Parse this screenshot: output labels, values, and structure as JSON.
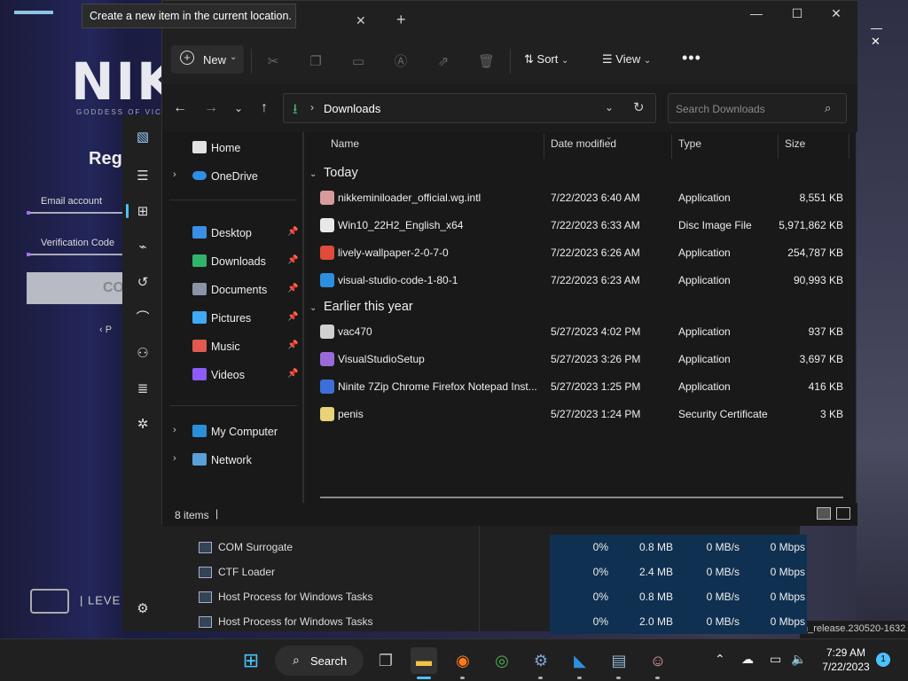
{
  "launcher": {
    "logo": "NIKK",
    "tagline": "GODDESS OF VIC",
    "register_heading": "Regis",
    "email_label": "Email account",
    "verification_label": "Verification Code",
    "button_text": "CO",
    "back_text": "P",
    "studio_text": "LEVE",
    "build_text": "n_release.230520-1632",
    "top_icons": "— ✕"
  },
  "taskmgr": {
    "rows": [
      {
        "name": "COM Surrogate",
        "cpu": "0%",
        "mem": "0.8 MB",
        "disk": "0 MB/s",
        "net": "0 Mbps"
      },
      {
        "name": "CTF Loader",
        "cpu": "0%",
        "mem": "2.4 MB",
        "disk": "0 MB/s",
        "net": "0 Mbps"
      },
      {
        "name": "Host Process for Windows Tasks",
        "cpu": "0%",
        "mem": "0.8 MB",
        "disk": "0 MB/s",
        "net": "0 Mbps"
      },
      {
        "name": "Host Process for Windows Tasks",
        "cpu": "0%",
        "mem": "2.0 MB",
        "disk": "0 MB/s",
        "net": "0 Mbps"
      }
    ]
  },
  "tooltip": {
    "text": "Create a new item in the current location."
  },
  "window": {
    "minimize": "—",
    "maximize": "☐",
    "close": "✕",
    "tab_close": "✕",
    "tab_add": "+"
  },
  "toolbar": {
    "new_label": "New",
    "sort_label": "Sort",
    "view_label": "View",
    "more_label": "•••"
  },
  "address": {
    "path": "Downloads",
    "search_placeholder": "Search Downloads"
  },
  "nav": {
    "home": "Home",
    "onedrive": "OneDrive",
    "quick": [
      {
        "label": "Desktop",
        "color": "#3a8ee6"
      },
      {
        "label": "Downloads",
        "color": "#2fb46a"
      },
      {
        "label": "Documents",
        "color": "#8a94a6"
      },
      {
        "label": "Pictures",
        "color": "#3fa9f5"
      },
      {
        "label": "Music",
        "color": "#e05a4f"
      },
      {
        "label": "Videos",
        "color": "#8b5cf6"
      }
    ],
    "my_computer": "My Computer",
    "network": "Network"
  },
  "columns": {
    "name": "Name",
    "date": "Date modified",
    "type": "Type",
    "size": "Size"
  },
  "groups": {
    "today": {
      "label": "Today",
      "files": [
        {
          "name": "nikkeminiloader_official.wg.intl",
          "date": "7/22/2023 6:40 AM",
          "type": "Application",
          "size": "8,551 KB",
          "icon": "nikke-app-icon",
          "color": "#d89a9a"
        },
        {
          "name": "Win10_22H2_English_x64",
          "date": "7/22/2023 6:33 AM",
          "type": "Disc Image File",
          "size": "5,971,862 KB",
          "icon": "disc-image-icon",
          "color": "#e8e8e8"
        },
        {
          "name": "lively-wallpaper-2-0-7-0",
          "date": "7/22/2023 6:26 AM",
          "type": "Application",
          "size": "254,787 KB",
          "icon": "lively-app-icon",
          "color": "#e04b3a"
        },
        {
          "name": "visual-studio-code-1-80-1",
          "date": "7/22/2023 6:23 AM",
          "type": "Application",
          "size": "90,993 KB",
          "icon": "vscode-app-icon",
          "color": "#2d8fe0"
        }
      ]
    },
    "earlier": {
      "label": "Earlier this year",
      "files": [
        {
          "name": "vac470",
          "date": "5/27/2023 4:02 PM",
          "type": "Application",
          "size": "937 KB",
          "icon": "installer-icon",
          "color": "#d0d0d0"
        },
        {
          "name": "VisualStudioSetup",
          "date": "5/27/2023 3:26 PM",
          "type": "Application",
          "size": "3,697 KB",
          "icon": "visual-studio-icon",
          "color": "#9b6ad9"
        },
        {
          "name": "Ninite 7Zip Chrome Firefox Notepad Inst...",
          "date": "5/27/2023 1:25 PM",
          "type": "Application",
          "size": "416 KB",
          "icon": "ninite-icon",
          "color": "#3d6fd9"
        },
        {
          "name": "penis",
          "date": "5/27/2023 1:24 PM",
          "type": "Security Certificate",
          "size": "3 KB",
          "icon": "certificate-icon",
          "color": "#e8d27a"
        }
      ]
    }
  },
  "status": {
    "item_count": "8 items"
  },
  "taskbar": {
    "search_label": "Search",
    "time": "7:29 AM",
    "date": "7/22/2023",
    "notification_count": "1"
  }
}
